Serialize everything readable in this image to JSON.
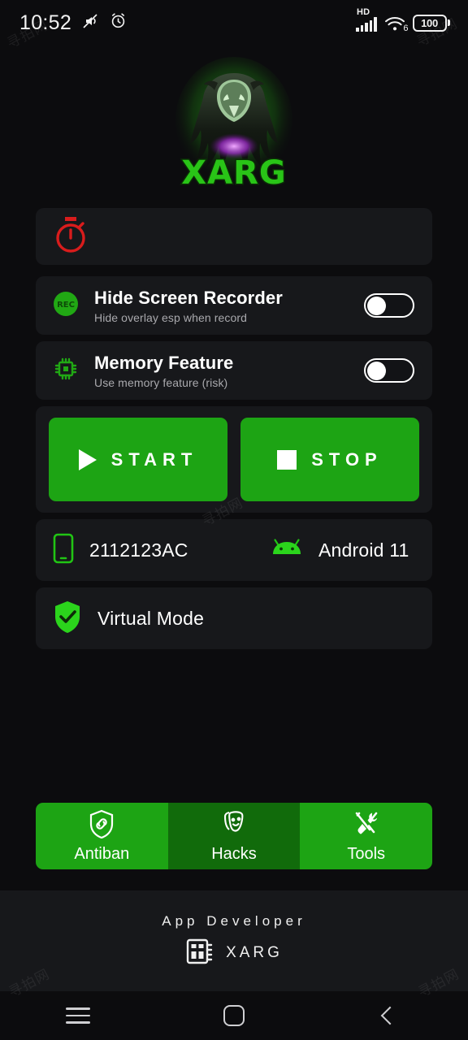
{
  "statusbar": {
    "time": "10:52",
    "icons": [
      "mute-icon",
      "alarm-icon"
    ],
    "network_label": "HD",
    "wifi_generation": "6",
    "battery_percent": "100"
  },
  "logo": {
    "name": "xarg-logo",
    "wordmark": "XARG",
    "glow_color": "#2ecc1e"
  },
  "timer_card": {
    "icon": "stopwatch-icon",
    "icon_color": "#d91c1c",
    "value": ""
  },
  "settings": [
    {
      "icon": "rec-icon",
      "title": "Hide Screen Recorder",
      "subtitle": "Hide overlay esp when record",
      "toggle_state": "off"
    },
    {
      "icon": "cpu-chip-icon",
      "title": "Memory Feature",
      "subtitle": "Use memory feature (risk)",
      "toggle_state": "off"
    }
  ],
  "actions": {
    "start_label": "START",
    "stop_label": "STOP",
    "button_color": "#1da414"
  },
  "device": {
    "model_icon": "phone-icon",
    "model": "2112123AC",
    "os_icon": "android-icon",
    "os": "Android 11"
  },
  "virtual_mode": {
    "icon": "shield-check-icon",
    "label": "Virtual Mode"
  },
  "bottom_nav": [
    {
      "icon": "shield-link-icon",
      "label": "Antiban",
      "selected": false
    },
    {
      "icon": "masks-icon",
      "label": "Hacks",
      "selected": true
    },
    {
      "icon": "tools-icon",
      "label": "Tools",
      "selected": false
    }
  ],
  "footer": {
    "title": "App Developer",
    "icon": "chip-board-icon",
    "brand": "XARG"
  },
  "system_nav": {
    "recents": "menu-icon",
    "home": "home-square-icon",
    "back": "back-chevron-icon"
  },
  "watermark": "寻拍网"
}
